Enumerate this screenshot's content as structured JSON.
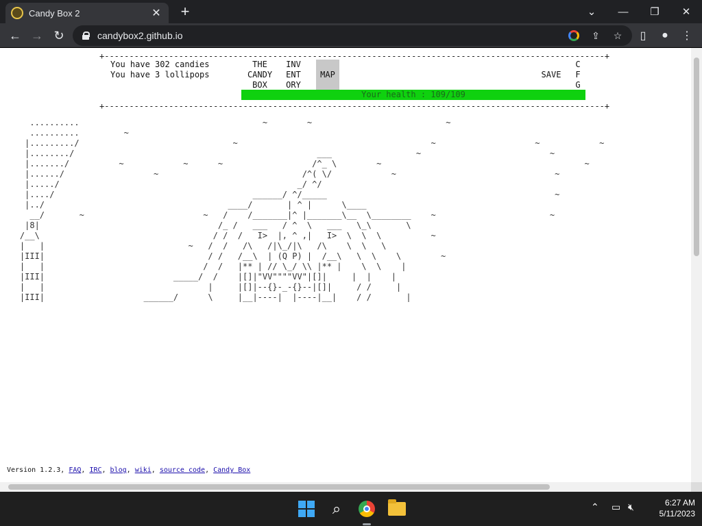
{
  "browser": {
    "tab_title": "Candy Box 2",
    "url": "candybox2.github.io",
    "new_tab_label": "+",
    "tab_close_label": "✕"
  },
  "status": {
    "candies": "You have 302 candies",
    "lollipops": "You have 3 lollipops",
    "health": "Your health : 109/109"
  },
  "menu": {
    "the_candy_box": [
      "THE",
      "CANDY",
      "BOX"
    ],
    "inventory": [
      "INV",
      "ENT",
      "ORY"
    ],
    "map": "MAP",
    "save": "SAVE",
    "cfg": [
      "C",
      "F",
      "G"
    ]
  },
  "footer": {
    "version": "Version 1.2.3,",
    "links": [
      "FAQ",
      "IRC",
      "blog",
      "wiki",
      "source code",
      "Candy Box"
    ]
  },
  "taskbar": {
    "time": "6:27 AM",
    "date": "5/11/2023"
  },
  "colors": {
    "health_bar": "#0fd10f",
    "active_menu": "#c8c8c8"
  }
}
